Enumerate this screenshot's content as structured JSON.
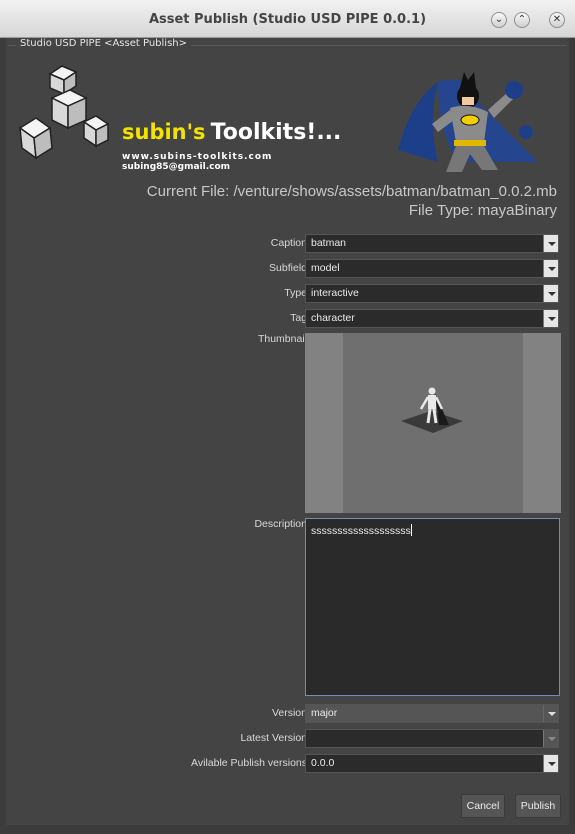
{
  "window": {
    "title": "Asset Publish (Studio USD PIPE 0.0.1)",
    "panel_title": "Studio USD PIPE <Asset Publish>"
  },
  "banner": {
    "brand_first": "subin's",
    "brand_second": "Toolkits!...",
    "website": "www.subins-toolkits.com",
    "email": "subing85@gmail.com"
  },
  "file": {
    "current_file": "Current File: /venture/shows/assets/batman/batman_0.0.2.mb",
    "file_type": "File Type: mayaBinary"
  },
  "form": {
    "caption_label": "Caption",
    "caption_value": "batman",
    "subfield_label": "Subfield",
    "subfield_value": "model",
    "type_label": "Type",
    "type_value": "interactive",
    "tag_label": "Tag",
    "tag_value": "character",
    "thumbnail_label": "Thumbnail",
    "description_label": "Description",
    "description_value": "sssssssssssssssssss",
    "version_label": "Version",
    "version_value": "major",
    "latest_version_label": "Latest Version",
    "latest_version_value": "",
    "publish_versions_label": "Avilable Publish versions",
    "publish_versions_value": "0.0.0"
  },
  "buttons": {
    "cancel": "Cancel",
    "publish": "Publish"
  },
  "colors": {
    "background": "#444444",
    "brand_yellow": "#f2e300",
    "focus_border": "#6a8fb8"
  }
}
